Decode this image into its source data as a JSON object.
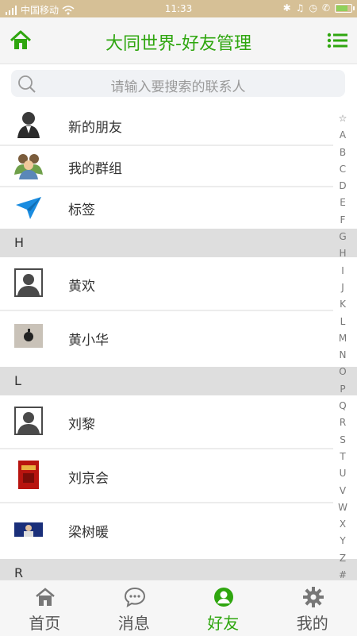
{
  "status": {
    "carrier": "中国移动",
    "time": "11:33",
    "battery_level": 0.85
  },
  "header": {
    "title": "大同世界-好友管理",
    "home_icon": "home-icon",
    "menu_icon": "list-menu-icon"
  },
  "search": {
    "placeholder": "请输入要搜索的联系人"
  },
  "quick_items": [
    {
      "label": "新的朋友",
      "icon": "new-friend-icon"
    },
    {
      "label": "我的群组",
      "icon": "group-icon"
    },
    {
      "label": "标签",
      "icon": "tag-plane-icon"
    }
  ],
  "sections": [
    {
      "letter": "H",
      "contacts": [
        "黄欢",
        "黄小华"
      ]
    },
    {
      "letter": "L",
      "contacts": [
        "刘黎",
        "刘京会",
        "梁树暖"
      ]
    },
    {
      "letter": "R",
      "contacts": []
    }
  ],
  "index_letters": [
    "☆",
    "A",
    "B",
    "C",
    "D",
    "E",
    "F",
    "G",
    "H",
    "I",
    "J",
    "K",
    "L",
    "M",
    "N",
    "O",
    "P",
    "Q",
    "R",
    "S",
    "T",
    "U",
    "V",
    "W",
    "X",
    "Y",
    "Z",
    "#"
  ],
  "tabs": [
    {
      "label": "首页",
      "icon": "home-tab-icon",
      "active": false
    },
    {
      "label": "消息",
      "icon": "message-icon",
      "active": false
    },
    {
      "label": "好友",
      "icon": "friends-icon",
      "active": true
    },
    {
      "label": "我的",
      "icon": "settings-gear-icon",
      "active": false
    }
  ],
  "colors": {
    "accent": "#2fa60f",
    "status_bar": "#d6c096",
    "section_bg": "#dedede"
  }
}
